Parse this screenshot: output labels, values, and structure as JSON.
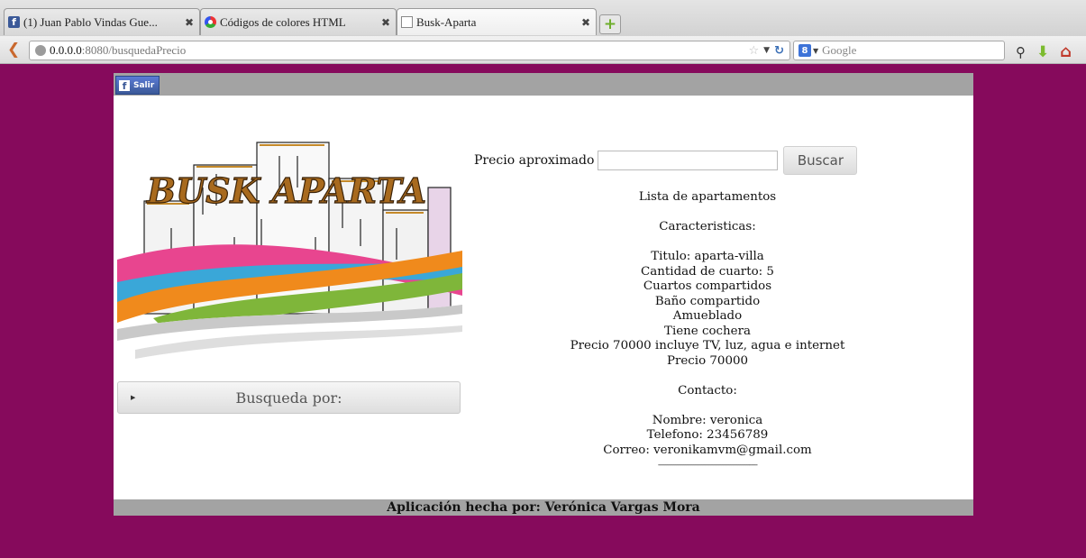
{
  "browser": {
    "tabs": [
      {
        "label": "(1) Juan Pablo Vindas Gue...",
        "icon": "facebook-icon"
      },
      {
        "label": "Códigos de colores HTML",
        "icon": "color-wheel-icon"
      },
      {
        "label": "Busk-Aparta",
        "icon": "blank-page-icon"
      }
    ],
    "new_tab": "+",
    "url_host": "0.0.0.0",
    "url_path": ":8080/busquedaPrecio",
    "search_placeholder": "Google",
    "search_engine_glyph": "8"
  },
  "page": {
    "fb_logout_label": "Salir",
    "logo_text": "BUSK APARTA",
    "accordion_label": "Busqueda por:",
    "search": {
      "label": "Precio aproximado",
      "value": "",
      "button": "Buscar"
    },
    "listing": {
      "heading": "Lista de apartamentos",
      "features_heading": "Caracteristicas:",
      "features": [
        "Titulo: aparta-villa",
        "Cantidad de cuarto: 5",
        "Cuartos compartidos",
        "Baño compartido",
        "Amueblado",
        "Tiene cochera",
        "Precio 70000 incluye TV, luz, agua e internet",
        "Precio 70000"
      ],
      "contact_heading": "Contacto:",
      "contact": [
        "Nombre: veronica",
        "Telefono: 23456789",
        "Correo: veronikamvm@gmail.com"
      ],
      "separator": "-------------------------------------------------"
    },
    "footer": "Aplicación hecha por: Verónica Vargas Mora"
  },
  "colors": {
    "page_background": "#860a5c",
    "bar_gray": "#a3a3a3",
    "facebook_blue": "#3b5998"
  }
}
